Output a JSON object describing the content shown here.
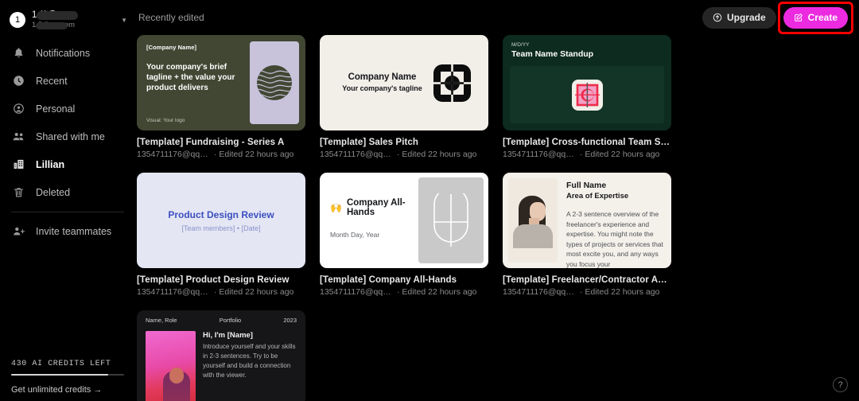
{
  "account": {
    "badge": "1",
    "primary": "1            /6@qq...",
    "secondary": "1              5@qq.com",
    "chevron": "chevron-down-icon"
  },
  "sidebar": {
    "items": [
      {
        "label": "Notifications",
        "icon": "bell-icon",
        "active": false
      },
      {
        "label": "Recent",
        "icon": "clock-icon",
        "active": false
      },
      {
        "label": "Personal",
        "icon": "person-circle-icon",
        "active": false
      },
      {
        "label": "Shared with me",
        "icon": "people-icon",
        "active": false
      },
      {
        "label": "Lillian",
        "icon": "building-icon",
        "active": true
      },
      {
        "label": "Deleted",
        "icon": "trash-icon",
        "active": false
      }
    ],
    "invite": {
      "label": "Invite teammates",
      "icon": "person-plus-icon"
    },
    "credits": {
      "label": "430 AI CREDITS LEFT",
      "percent": 86,
      "link": "Get unlimited credits →"
    }
  },
  "topbar": {
    "section_title": "Recently edited",
    "upgrade_label": "Upgrade",
    "create_label": "Create",
    "highlight_color": "#ff0000",
    "create_color": "#ec2ae0"
  },
  "cards": [
    {
      "title": "[Template] Fundraising - Series A",
      "owner": "1354711176@qq.c...",
      "edited": "· Edited 22 hours ago",
      "thumb": {
        "style": "fundraising",
        "company": "[Company Name]",
        "tagline": "Your company's brief tagline + the value your product delivers",
        "visual": "Visual: Your logo",
        "bg": "#414733",
        "panel": "#c8c3db"
      }
    },
    {
      "title": "[Template] Sales Pitch",
      "owner": "1354711176@qq.c...",
      "edited": "· Edited 22 hours ago",
      "thumb": {
        "style": "salespitch",
        "heading": "Company Name",
        "sub": "Your company's tagline",
        "bg": "#f2efe9"
      }
    },
    {
      "title": "[Template] Cross-functional Team Stand...",
      "owner": "1354711176@qq.c...",
      "edited": "· Edited 22 hours ago",
      "thumb": {
        "style": "standup",
        "date": "M/D/YY",
        "heading": "Team Name Standup",
        "bg": "#0d2b1f"
      }
    },
    {
      "title": "[Template] Product Design Review",
      "owner": "1354711176@qq.c...",
      "edited": "· Edited 22 hours ago",
      "thumb": {
        "style": "designreview",
        "heading": "Product Design Review",
        "sub": "[Team members] • [Date]",
        "bg": "#e4e6f4"
      }
    },
    {
      "title": "[Template] Company All-Hands",
      "owner": "1354711176@qq.c...",
      "edited": "· Edited 22 hours ago",
      "thumb": {
        "style": "allhands",
        "emoji": "🙌",
        "heading": "Company All-Hands",
        "sub": "Month Day, Year",
        "bg": "#ffffff"
      }
    },
    {
      "title": "[Template] Freelancer/Contractor About ...",
      "owner": "1354711176@qq.c...",
      "edited": "· Edited 22 hours ago",
      "thumb": {
        "style": "freelancer",
        "heading": "Full Name",
        "subheading": "Area of Expertise",
        "body": "A 2-3 sentence overview of the freelancer's experience and expertise. You might note the types of projects or services that most excite you, and any ways you focus your",
        "bg": "#f4f1ea"
      }
    },
    {
      "title": "",
      "owner": "",
      "edited": "",
      "thumb": {
        "style": "portfolio",
        "name_role": "Name, Role",
        "portfolio": "Portfolio",
        "year": "2023",
        "heading": "Hi, I'm [Name]",
        "body": "Introduce yourself and your skills in 2-3 sentences. Try to be yourself and build a connection with the viewer.",
        "bg": "#161618"
      }
    }
  ],
  "help": {
    "glyph": "?"
  }
}
